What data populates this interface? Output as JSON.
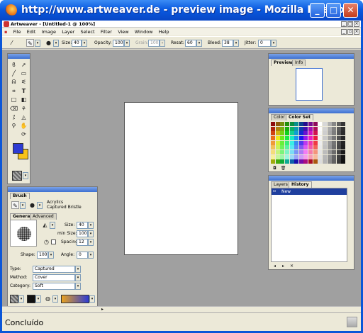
{
  "browser": {
    "title": "http://www.artweaver.de - preview image - Mozilla Firefox",
    "status": "Concluído"
  },
  "app": {
    "title": "Artweaver - [Untitled-1 @ 100%]",
    "menu": [
      "File",
      "Edit",
      "Image",
      "Layer",
      "Select",
      "Filter",
      "View",
      "Window",
      "Help"
    ]
  },
  "options": {
    "size_label": "Size:",
    "size_value": "40",
    "opacity_label": "Opacity:",
    "opacity_value": "100",
    "grain_label": "Grain:",
    "grain_value": "100",
    "resat_label": "Resat:",
    "resat_value": "60",
    "bleed_label": "Bleed:",
    "bleed_value": "38",
    "jitter_label": "Jitter:",
    "jitter_value": "0"
  },
  "brush_panel": {
    "title": "Brush",
    "category_name": "Acrylics",
    "variant_name": "Captured Bristle",
    "tabs": [
      "General",
      "Advanced"
    ],
    "size_label": "Size:",
    "size_value": "40",
    "min_size_label": "min Size:",
    "min_size_value": "100",
    "spacing_label": "Spacing:",
    "spacing_value": "12",
    "shape_label": "Shape:",
    "shape_value": "100",
    "angle_label": "Angle:",
    "angle_value": "0",
    "type_label": "Type:",
    "type_value": "Captured",
    "method_label": "Method:",
    "method_value": "Cover",
    "category_label": "Category:",
    "category_value": "Soft"
  },
  "preview_panel": {
    "tabs": [
      "Preview",
      "Info"
    ]
  },
  "color_panel": {
    "tabs": [
      "Color",
      "Color Set"
    ]
  },
  "layers_panel": {
    "tabs": [
      "Layers",
      "History"
    ],
    "items": [
      "New"
    ]
  },
  "colors": {
    "foreground": "#2d3bd4",
    "background": "#f7c21a",
    "history_selected": "#1f3f9e"
  }
}
